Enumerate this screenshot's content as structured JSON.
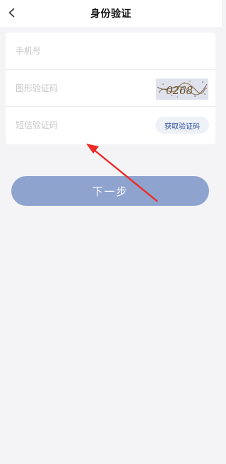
{
  "header": {
    "title": "身份验证",
    "back_icon": "chevron-left-icon"
  },
  "form": {
    "phone": {
      "placeholder": "手机号",
      "value": ""
    },
    "captcha": {
      "placeholder": "图形验证码",
      "value": "",
      "image_text": "0268"
    },
    "sms": {
      "placeholder": "短信验证码",
      "value": "",
      "button_label": "获取验证码"
    }
  },
  "actions": {
    "next_label": "下一步"
  },
  "colors": {
    "primary_button": "#8fa3cf",
    "sms_button_text": "#2a4f9a",
    "annotation_arrow": "#ee2a24"
  }
}
